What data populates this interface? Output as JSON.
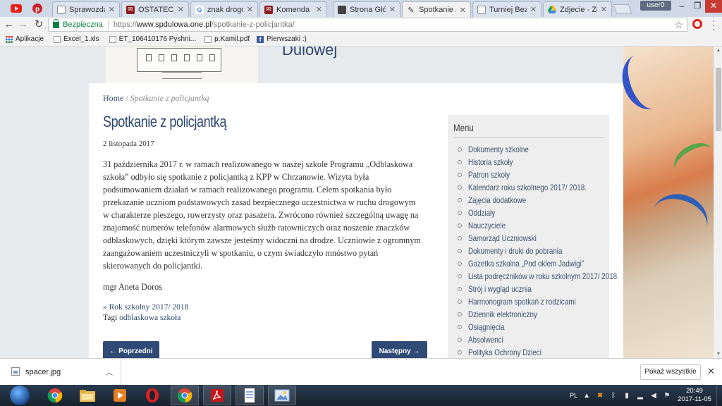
{
  "browser": {
    "tabs": [
      {
        "label": "Sprawozdanie",
        "icon": "document-icon",
        "color": "#ffffff"
      },
      {
        "label": "OSTATECZNE",
        "icon": "email-icon",
        "color": "#8b1a1a"
      },
      {
        "label": "znak drogowy",
        "icon": "google-icon",
        "color": "#4285f4"
      },
      {
        "label": "Komenda Pow",
        "icon": "email-icon",
        "color": "#8b1a1a"
      },
      {
        "label": "Strona Główna",
        "icon": "site-icon",
        "color": "#444444"
      },
      {
        "label": "Spotkanie z p",
        "icon": "pen-icon",
        "color": "#333333",
        "active": true
      },
      {
        "label": "Turniej Bezpie",
        "icon": "document-icon",
        "color": "#ffffff"
      },
      {
        "label": "Zdjecie - Zdję",
        "icon": "drive-icon",
        "color": "#f4b400"
      }
    ],
    "user_badge": "user0",
    "secure_label": "Bezpieczna",
    "url_prefix": "https://",
    "url_host": "www.spdulowa.one.pl",
    "url_path": "/spotkanie-z-policjantka/",
    "bookmarks": [
      {
        "label": "Aplikacje",
        "icon": "apps-icon"
      },
      {
        "label": "Excel_1.xls",
        "icon": "file-icon"
      },
      {
        "label": "ET_106410176 Pyshni...",
        "icon": "file-icon"
      },
      {
        "label": "p.Kamil.pdf",
        "icon": "file-icon"
      },
      {
        "label": "Pierwszaki :)",
        "icon": "facebook-icon"
      }
    ]
  },
  "site": {
    "name": "Dulowej"
  },
  "breadcrumb": {
    "home": "Home",
    "separator": "/",
    "current": "Spotkanie z policjantką"
  },
  "post": {
    "title": "Spotkanie z policjantką",
    "date": "2 listopada 2017",
    "body": "31 października 2017 r. w ramach realizowanego w naszej szkole Programu „Odblaskowa szkoła” odbyło się spotkanie z policjantką z KPP w Chrzanowie. Wizyta była podsumowaniem działań w ramach realizowanego programu. Celem spotkania było przekazanie uczniom podstawowych zasad bezpiecznego uczestnictwa w ruchu drogowym w charakterze pieszego, rowerzysty oraz pasażera. Zwrócono również szczególną uwagę na znajomość numerów telefonów alarmowych służb ratowniczych oraz noszenie znaczków odblaskowych, dzięki którym zawsze jesteśmy widoczni na drodze. Uczniowie z ogromnym zaangażowaniem uczestniczyli w spotkaniu, o czym świadczyło mnóstwo pytań skierowanych do  policjantki.",
    "signature": "mgr Aneta Doros",
    "category_prefix": "»",
    "category": "Rok szkolny 2017/ 2018",
    "tags_label": "Tagi",
    "tag": "odblaskowa szkoła",
    "prev_label": "← Poprzedni",
    "next_label": "Następny →"
  },
  "sidebar": {
    "title": "Menu",
    "items": [
      "Dokumenty szkolne",
      "Historia szkoły",
      "Patron szkoły",
      "Kalendarz roku szkolnego 2017/ 2018.",
      "Zajęcia dodatkowe",
      "Oddziały",
      "Nauczyciele",
      "Samorząd Uczniowski",
      "Dokumenty i druki do pobrania",
      "Gazetka szkolna „Pod okiem Jadwigi”",
      "Lista podręczników w roku szkolnym 2017/ 2018",
      "Strój i wygląd ucznia",
      "Harmonogram spotkań z rodzicami",
      "Dziennik elektroniczny",
      "Osiągnięcia",
      "Absolwenci",
      "Polityka Ochrony Dzieci"
    ]
  },
  "downloads": {
    "file": "spacer.jpg",
    "show_all": "Pokaż wszystkie"
  },
  "taskbar": {
    "language": "PL",
    "time": "20:49",
    "date": "2017-11-05",
    "apps": [
      "chrome-icon",
      "explorer-icon",
      "media-player-icon",
      "opera-icon",
      "chrome-icon",
      "pdf-icon",
      "notepad-icon",
      "image-viewer-icon"
    ]
  },
  "colors": {
    "accent": "#2d4770",
    "button": "#2f4a75",
    "secure": "#0b8043"
  }
}
